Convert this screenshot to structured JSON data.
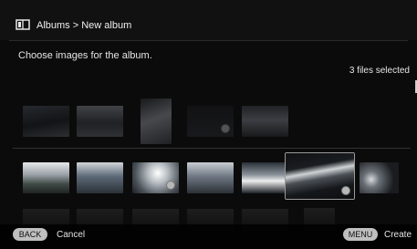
{
  "header": {
    "title": "Albums > New album"
  },
  "instruction": "Choose images for the album.",
  "selection_count": "3 files selected",
  "footer": {
    "back_key": "BACK",
    "back_label": "Cancel",
    "menu_key": "MENU",
    "menu_label": "Create"
  },
  "icons": {
    "album": "album-book-icon",
    "check": "check-mark-icon"
  },
  "colors": {
    "background": "#0b0b0b",
    "text": "#e8e8e8",
    "pill": "#bfbfbf",
    "selection_border": "#9a9a9a"
  }
}
